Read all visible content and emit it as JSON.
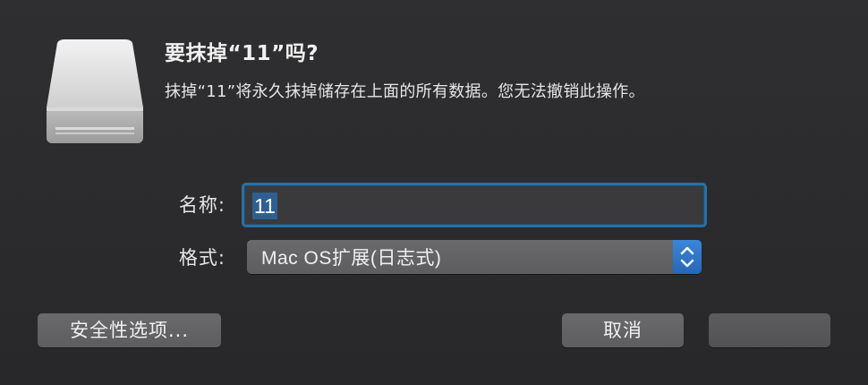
{
  "dialog": {
    "title": "要抹掉“11”吗?",
    "message": "抹掉“11”将永久抹掉储存在上面的所有数据。您无法撤销此操作。"
  },
  "form": {
    "name_label": "名称:",
    "name_value": "11",
    "format_label": "格式:",
    "format_value": "Mac OS扩展(日志式)"
  },
  "buttons": {
    "security": "安全性选项...",
    "cancel": "取消",
    "erase": ""
  },
  "icons": {
    "drive": "external-drive-icon",
    "stepper": "chevron-up-down-icon"
  },
  "colors": {
    "accent": "#2b6fa0",
    "selection": "#2f5f91",
    "stepper": "#2f74c8"
  }
}
